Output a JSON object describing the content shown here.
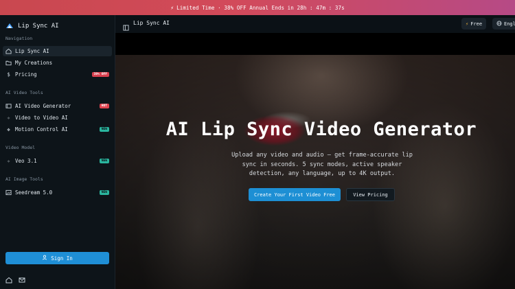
{
  "promo": {
    "icon": "bolt-icon",
    "text": "Limited Time · 38% OFF Annual  Ends in  28h : 47m : 37s"
  },
  "sidebar": {
    "brand": "Lip Sync AI",
    "sections": [
      {
        "label": "Navigation"
      },
      {
        "label": "AI Video Tools"
      },
      {
        "label": "Video Model"
      },
      {
        "label": "AI Image Tools"
      }
    ],
    "items": [
      {
        "label": "Lip Sync AI",
        "icon": "home-icon",
        "active": true
      },
      {
        "label": "My Creations",
        "icon": "folder-icon"
      },
      {
        "label": "Pricing",
        "icon": "dollar-icon",
        "badge": "38% OFF"
      },
      {
        "label": "AI Video Generator",
        "icon": "film-icon",
        "badge": "HOT"
      },
      {
        "label": "Video to Video AI",
        "icon": "sparkle-icon"
      },
      {
        "label": "Motion Control AI",
        "icon": "move-icon",
        "badge": "NEW"
      },
      {
        "label": "Veo 3.1",
        "icon": "sparkle-icon",
        "badge": "NEW"
      },
      {
        "label": "Seedream 5.0",
        "icon": "image-icon",
        "badge": "NEW"
      }
    ],
    "signin_label": "Sign In"
  },
  "topbar": {
    "title": "Lip Sync AI",
    "plan_label": "Free",
    "language_label": "English"
  },
  "hero": {
    "title": "AI Lip Sync Video Generator",
    "subtitle": "Upload any video and audio — get frame-accurate lip sync in seconds. 5 sync modes, active speaker detection, any language, up to 4K output.",
    "primary_cta": "Create Your First Video Free",
    "secondary_cta": "View Pricing"
  },
  "colors": {
    "accent": "#1f8fd6",
    "promo_start": "#c9484f",
    "promo_end": "#b64a86",
    "badge_hot": "#e04450",
    "badge_new": "#2ab59e"
  }
}
